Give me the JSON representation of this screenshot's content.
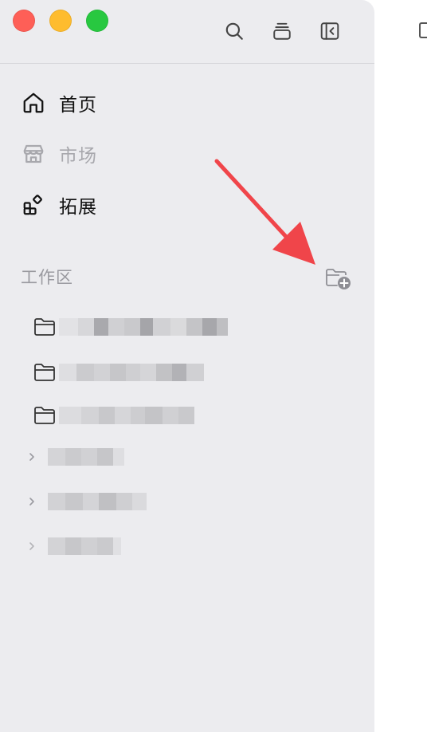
{
  "window": {
    "traffic_colors": {
      "close": "#fe5f57",
      "minimize": "#febc2e",
      "maximize": "#28c840"
    },
    "toolbar_icons": [
      "search-icon",
      "stack-icon",
      "sidebar-collapse-icon"
    ]
  },
  "nav": {
    "items": [
      {
        "label": "首页",
        "icon": "home-icon",
        "state": "normal"
      },
      {
        "label": "市场",
        "icon": "store-icon",
        "state": "disabled"
      },
      {
        "label": "拓展",
        "icon": "extensions-icon",
        "state": "normal"
      }
    ]
  },
  "workspace": {
    "title": "工作区",
    "add_icon": "folder-add-icon",
    "folders_redacted": 3,
    "groups_redacted": 3
  },
  "annotation": {
    "arrow_color": "#f0454a",
    "points_to": "folder-add-icon"
  }
}
